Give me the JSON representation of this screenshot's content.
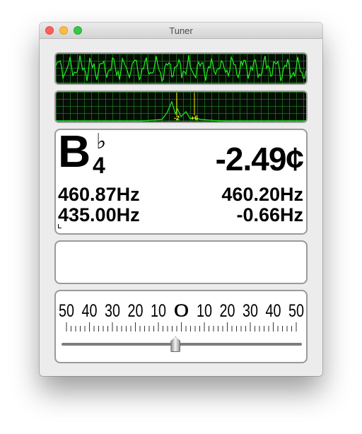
{
  "window": {
    "title": "Tuner"
  },
  "note": {
    "letter": "B",
    "accidental": "♭",
    "octave": "4"
  },
  "cents_display": "-2.49¢",
  "frequencies": {
    "measured": "460.87Hz",
    "reference": "460.20Hz",
    "target": "435.00Hz",
    "difference": "-0.66Hz"
  },
  "spectrum": {
    "marker_labels": [
      "-2",
      "+6"
    ]
  },
  "meter": {
    "scale_labels": [
      "50",
      "40",
      "30",
      "20",
      "10",
      "0",
      "10",
      "20",
      "30",
      "40",
      "50"
    ],
    "slider_position_cents": -2.49
  },
  "colors": {
    "trace": "#22ee22",
    "grid": "#237823",
    "marker": "#ffee00",
    "scope_background": "#050d05"
  }
}
